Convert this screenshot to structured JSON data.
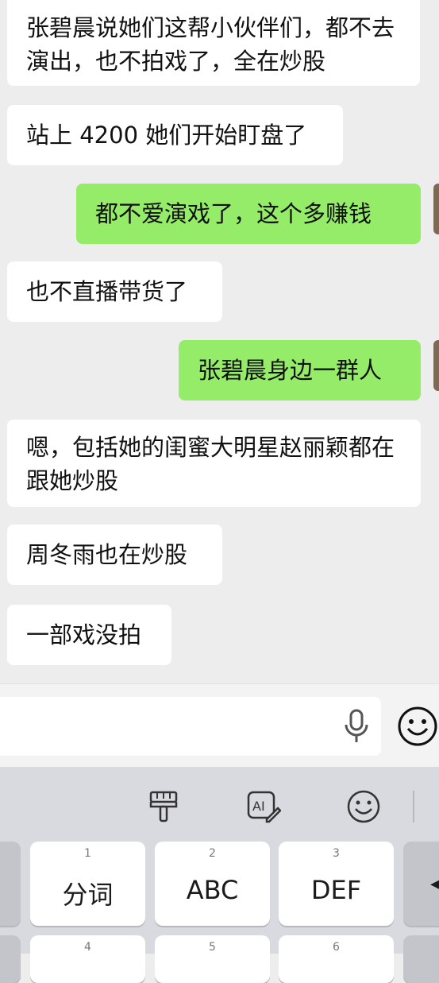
{
  "messages": [
    {
      "side": "in",
      "text": "张碧晨说她们这帮小伙伴们，都不去演出，也不拍戏了，全在炒股"
    },
    {
      "side": "in",
      "text": "站上 4200 她们开始盯盘了"
    },
    {
      "side": "out",
      "text": "都不爱演戏了，这个多赚钱"
    },
    {
      "side": "in",
      "text": "也不直播带货了"
    },
    {
      "side": "out",
      "text": "张碧晨身边一群人"
    },
    {
      "side": "in",
      "text": "嗯，包括她的闺蜜大明星赵丽颖都在跟她炒股"
    },
    {
      "side": "in",
      "text": "周冬雨也在炒股"
    },
    {
      "side": "in",
      "text": "一部戏没拍"
    }
  ],
  "input": {
    "value": "",
    "placeholder": ""
  },
  "toolbar": {
    "icons": [
      "paintbrush-icon",
      "ai-write-icon",
      "emoji-smile-icon"
    ]
  },
  "keyboard": {
    "row1": [
      {
        "num": "1",
        "label": "分词"
      },
      {
        "num": "2",
        "label": "ABC"
      },
      {
        "num": "3",
        "label": "DEF"
      }
    ],
    "row2": [
      {
        "num": "4",
        "label": ""
      },
      {
        "num": "5",
        "label": ""
      },
      {
        "num": "6",
        "label": ""
      }
    ]
  },
  "colors": {
    "background": "#ededed",
    "incoming_bubble": "#ffffff",
    "outgoing_bubble": "#95ec69",
    "keyboard": "#d9dadf"
  }
}
